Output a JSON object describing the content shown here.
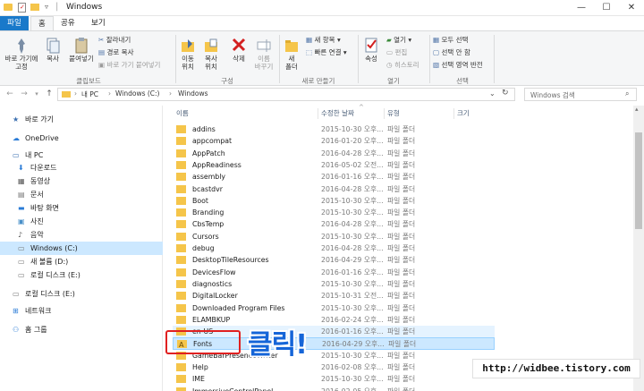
{
  "window": {
    "title": "Windows",
    "controls": {
      "minimize": "—",
      "maximize": "☐",
      "close": "✕"
    }
  },
  "tabs": [
    {
      "label": "파일"
    },
    {
      "label": "홈"
    },
    {
      "label": "공유"
    },
    {
      "label": "보기"
    }
  ],
  "ribbon": {
    "clipboard": {
      "pin": "바로 가기에\n고정",
      "copy": "복사",
      "paste": "붙여넣기",
      "cut": "잘라내기",
      "copy_path": "경로 복사",
      "paste_shortcut": "바로 가기 붙여넣기",
      "group": "클립보드"
    },
    "organize": {
      "move": "이동\n위치",
      "copy_to": "복사\n위치",
      "delete": "삭제",
      "rename": "이름\n바꾸기",
      "group": "구성"
    },
    "new": {
      "folder": "새\n폴더",
      "new_item": "새 항목",
      "easy_access": "빠른 연결",
      "group": "새로 만들기"
    },
    "open": {
      "properties": "속성",
      "open": "열기",
      "edit": "편집",
      "history": "히스토리",
      "group": "열기"
    },
    "select": {
      "select_all": "모두 선택",
      "select_none": "선택 안 함",
      "invert": "선택 영역 반전",
      "group": "선택"
    }
  },
  "address": {
    "path": [
      "내 PC",
      "Windows (C:)",
      "Windows"
    ],
    "search_placeholder": "Windows 검색"
  },
  "nav": [
    {
      "label": "바로 가기",
      "icon": "star-icon",
      "indent": 0
    },
    {
      "label": "OneDrive",
      "icon": "cloud-icon",
      "indent": 0
    },
    {
      "label": "내 PC",
      "icon": "pc-icon",
      "indent": 0
    },
    {
      "label": "다운로드",
      "icon": "download-icon",
      "indent": 1
    },
    {
      "label": "동영상",
      "icon": "video-icon",
      "indent": 1
    },
    {
      "label": "문서",
      "icon": "document-icon",
      "indent": 1
    },
    {
      "label": "바탕 화면",
      "icon": "desktop-icon",
      "indent": 1
    },
    {
      "label": "사진",
      "icon": "picture-icon",
      "indent": 1
    },
    {
      "label": "음악",
      "icon": "music-icon",
      "indent": 1
    },
    {
      "label": "Windows (C:)",
      "icon": "drive-icon",
      "indent": 1,
      "selected": true
    },
    {
      "label": "새 볼륨 (D:)",
      "icon": "drive-icon",
      "indent": 1
    },
    {
      "label": "로컬 디스크 (E:)",
      "icon": "drive-icon",
      "indent": 1
    },
    {
      "label": "로컬 디스크 (E:)",
      "icon": "drive-icon",
      "indent": 0
    },
    {
      "label": "네트워크",
      "icon": "network-icon",
      "indent": 0
    },
    {
      "label": "홈 그룹",
      "icon": "homegroup-icon",
      "indent": 0
    }
  ],
  "columns": {
    "name": "이름",
    "date": "수정한 날짜",
    "type": "유형",
    "size": "크기"
  },
  "files": [
    {
      "name": "addins",
      "date": "2015-10-30 오후...",
      "type": "파일 폴더"
    },
    {
      "name": "appcompat",
      "date": "2016-01-20 오후...",
      "type": "파일 폴더"
    },
    {
      "name": "AppPatch",
      "date": "2016-04-28 오후...",
      "type": "파일 폴더"
    },
    {
      "name": "AppReadiness",
      "date": "2016-05-02 오전...",
      "type": "파일 폴더"
    },
    {
      "name": "assembly",
      "date": "2016-01-16 오후...",
      "type": "파일 폴더"
    },
    {
      "name": "bcastdvr",
      "date": "2016-04-28 오후...",
      "type": "파일 폴더"
    },
    {
      "name": "Boot",
      "date": "2015-10-30 오후...",
      "type": "파일 폴더"
    },
    {
      "name": "Branding",
      "date": "2015-10-30 오후...",
      "type": "파일 폴더"
    },
    {
      "name": "CbsTemp",
      "date": "2016-04-28 오후...",
      "type": "파일 폴더"
    },
    {
      "name": "Cursors",
      "date": "2015-10-30 오후...",
      "type": "파일 폴더"
    },
    {
      "name": "debug",
      "date": "2016-04-28 오후...",
      "type": "파일 폴더"
    },
    {
      "name": "DesktopTileResources",
      "date": "2016-04-29 오후...",
      "type": "파일 폴더"
    },
    {
      "name": "DevicesFlow",
      "date": "2016-01-16 오후...",
      "type": "파일 폴더"
    },
    {
      "name": "diagnostics",
      "date": "2015-10-30 오후...",
      "type": "파일 폴더"
    },
    {
      "name": "DigitalLocker",
      "date": "2015-10-31 오전...",
      "type": "파일 폴더"
    },
    {
      "name": "Downloaded Program Files",
      "date": "2015-10-30 오후...",
      "type": "파일 폴더"
    },
    {
      "name": "ELAMBKUP",
      "date": "2016-02-24 오후...",
      "type": "파일 폴더"
    },
    {
      "name": "en-US",
      "date": "2016-01-16 오후...",
      "type": "파일 폴더",
      "highlight": true
    },
    {
      "name": "Fonts",
      "date": "2016-04-29 오후...",
      "type": "파일 폴더",
      "selected": true
    },
    {
      "name": "GameBarPresenceWriter",
      "date": "2015-10-30 오후...",
      "type": "파일 폴더"
    },
    {
      "name": "Help",
      "date": "2016-02-08 오후...",
      "type": "파일 폴더"
    },
    {
      "name": "IME",
      "date": "2015-10-30 오후...",
      "type": "파일 폴더"
    },
    {
      "name": "ImmersiveControlPanel",
      "date": "2016-02-05 오후...",
      "type": "파일 폴더"
    }
  ],
  "annotation": {
    "click_text": "클릭!"
  },
  "watermark": "http://widbee.tistory.com",
  "colors": {
    "accent": "#1979ca",
    "folder": "#f5c54a",
    "selection": "#cce8ff",
    "annotation_red": "#e02020",
    "annotation_blue": "#1565d8"
  }
}
